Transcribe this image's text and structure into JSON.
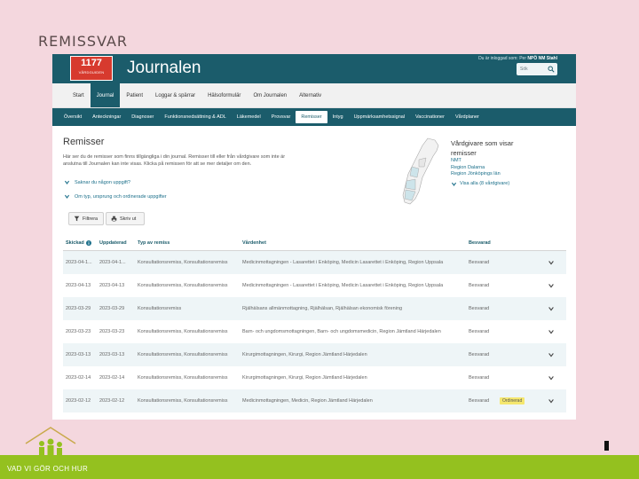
{
  "slide": {
    "title": "REMISSVAR",
    "footer_text": "VAD VI GÖR OCH HUR"
  },
  "header": {
    "brand_number": "1177",
    "brand_sub": "VÅRDGUIDEN",
    "app_title": "Journalen",
    "login_prefix": "Du är inloggad som: Per",
    "login_user": "NPÖ NM Stahl",
    "search_placeholder": "Sök"
  },
  "main_nav": [
    {
      "label": "Start",
      "active": false
    },
    {
      "label": "Journal",
      "active": true
    },
    {
      "label": "Patient",
      "active": false
    },
    {
      "label": "Loggar & spärrar",
      "active": false
    },
    {
      "label": "Hälsoformulär",
      "active": false
    },
    {
      "label": "Om Journalen",
      "active": false
    },
    {
      "label": "Alternativ",
      "active": false
    }
  ],
  "sub_nav": [
    {
      "label": "Översikt",
      "active": false
    },
    {
      "label": "Anteckningar",
      "active": false
    },
    {
      "label": "Diagnoser",
      "active": false
    },
    {
      "label": "Funktionsnedsättning & ADL",
      "active": false
    },
    {
      "label": "Läkemedel",
      "active": false
    },
    {
      "label": "Provsvar",
      "active": false
    },
    {
      "label": "Remisser",
      "active": true
    },
    {
      "label": "Intyg",
      "active": false
    },
    {
      "label": "Uppmärksamhetssignal",
      "active": false
    },
    {
      "label": "Vaccinationer",
      "active": false
    },
    {
      "label": "Vårdplaner",
      "active": false
    }
  ],
  "content": {
    "page_title": "Remisser",
    "intro": "Här ser du de remisser som finns tillgängliga i din journal. Remisser till eller från vårdgivare som inte är anslutna till Journalen kan inte visas. Klicka på remissen för att se mer detaljer om den.",
    "expander_1": "Saknar du någon uppgift?",
    "expander_2": "Om typ, ursprung och ordinerade uppgifter",
    "providers_title": "Vårdgivare som visar remisser",
    "providers": [
      "NMT",
      "Region Dalarna",
      "Region Jönköpings län"
    ],
    "show_all": "Visa alla (8 vårdgivare)",
    "filter_button": "Filtrera",
    "print_button": "Skriv ut"
  },
  "table": {
    "headers": [
      "Skickad",
      "Uppdaterad",
      "Typ av remiss",
      "Vårdenhet",
      "Besvarad"
    ],
    "rows": [
      {
        "sent": "2023-04-1...",
        "updated": "2023-04-1...",
        "type": "Konsultationsremiss, Konsultationsremiss",
        "unit": "Medicinmottagningen - Lasarettet i Enköping, Medicin Lasarettet i Enköping, Region Uppsala",
        "answered": "Besvarad",
        "badge": ""
      },
      {
        "sent": "2023-04-13",
        "updated": "2023-04-13",
        "type": "Konsultationsremiss, Konsultationsremiss",
        "unit": "Medicinmottagningen - Lasarettet i Enköping, Medicin Lasarettet i Enköping, Region Uppsala",
        "answered": "Besvarad",
        "badge": ""
      },
      {
        "sent": "2023-03-29",
        "updated": "2023-03-29",
        "type": "Konsultationsremiss",
        "unit": "Rjälhälsans allmänmottagning, Rjälhälsan, Rjälhälsan ekonomisk förening",
        "answered": "Besvarad",
        "badge": ""
      },
      {
        "sent": "2023-03-23",
        "updated": "2023-03-23",
        "type": "Konsultationsremiss, Konsultationsremiss",
        "unit": "Barn- och ungdomsmottagningen, Barn- och ungdomsmedicin, Region Jämtland Härjedalen",
        "answered": "Besvarad",
        "badge": ""
      },
      {
        "sent": "2023-03-13",
        "updated": "2023-03-13",
        "type": "Konsultationsremiss, Konsultationsremiss",
        "unit": "Kirurgimottagningen, Kirurgi, Region Jämtland Härjedalen",
        "answered": "Besvarad",
        "badge": ""
      },
      {
        "sent": "2023-02-14",
        "updated": "2023-02-14",
        "type": "Konsultationsremiss, Konsultationsremiss",
        "unit": "Kirurgimottagningen, Kirurgi, Region Jämtland Härjedalen",
        "answered": "Besvarad",
        "badge": ""
      },
      {
        "sent": "2023-02-12",
        "updated": "2023-02-12",
        "type": "Konsultationsremiss, Konsultationsremiss",
        "unit": "Medicinmottagningen, Medicin, Region Jämtland Härjedalen",
        "answered": "Besvarad",
        "badge": "Ordinerad"
      }
    ]
  },
  "colors": {
    "header_teal": "#1b5c6b",
    "brand_red": "#d73a2e",
    "slide_pink": "#f4d7de",
    "footer_green": "#94c11f"
  }
}
